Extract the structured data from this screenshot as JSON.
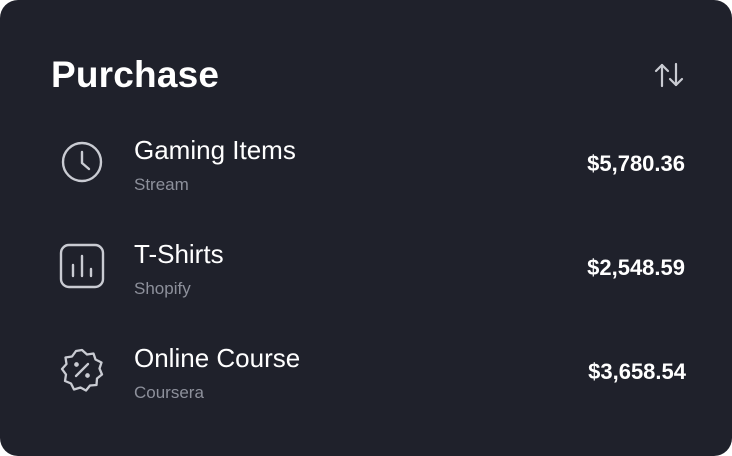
{
  "card": {
    "title": "Purchase",
    "sort_icon": "sort-arrows-icon"
  },
  "items": [
    {
      "name": "Gaming Items",
      "source": "Stream",
      "amount": "$5,780.36",
      "icon": "clock-icon"
    },
    {
      "name": "T-Shirts",
      "source": "Shopify",
      "amount": "$2,548.59",
      "icon": "bar-chart-icon"
    },
    {
      "name": "Online Course",
      "source": "Coursera",
      "amount": "$3,658.54",
      "icon": "discount-badge-icon"
    }
  ],
  "colors": {
    "background": "#1f212b",
    "text": "#ffffff",
    "muted": "#8d909b",
    "icon": "#c9cbd2"
  }
}
